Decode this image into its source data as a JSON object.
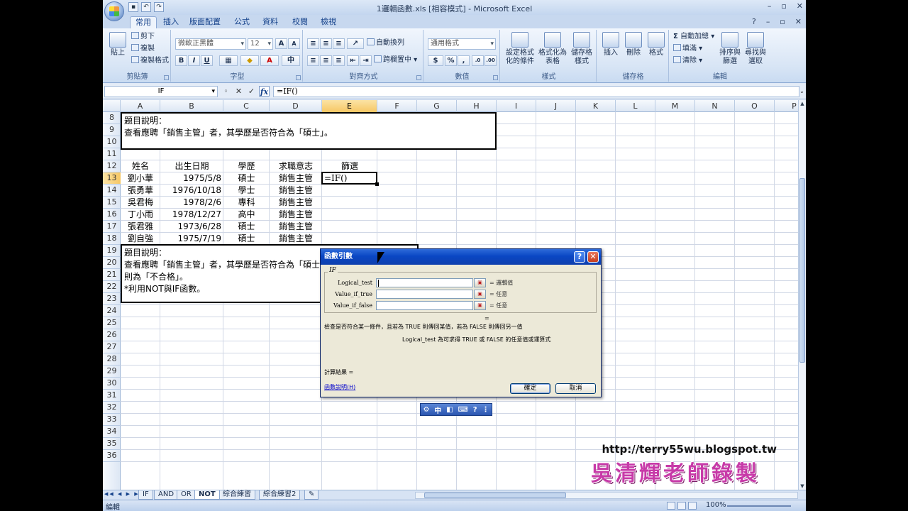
{
  "window": {
    "title": "1邏輯函數.xls [相容模式] - Microsoft Excel",
    "min": "–",
    "restore": "▫",
    "close": "✕"
  },
  "ribbon_tabs": [
    "常用",
    "插入",
    "版面配置",
    "公式",
    "資料",
    "校閱",
    "檢視"
  ],
  "ribbon": {
    "clipboard": {
      "label": "剪貼簿",
      "paste": "貼上",
      "cut": "剪下",
      "copy": "複製",
      "format_painter": "複製格式"
    },
    "font": {
      "label": "字型",
      "font_name": "微軟正黑體",
      "font_size": "12",
      "bold": "B",
      "italic": "I",
      "underline": "U"
    },
    "alignment": {
      "label": "對齊方式",
      "wrap": "自動換列",
      "merge": "跨欄置中"
    },
    "number": {
      "label": "數值",
      "format": "通用格式",
      "currency": "$",
      "percent": "%",
      "comma": ","
    },
    "styles": {
      "label": "樣式",
      "conditional": "設定格式化的條件",
      "table": "格式化為表格",
      "cell_styles": "儲存格樣式"
    },
    "cells": {
      "label": "儲存格",
      "insert": "插入",
      "delete": "刪除",
      "format": "格式"
    },
    "editing": {
      "label": "編輯",
      "autosum": "自動加總",
      "fill": "填滿",
      "clear": "清除",
      "sort": "排序與篩選",
      "find": "尋找與選取"
    }
  },
  "formula_bar": {
    "name_box": "IF",
    "cancel": "✕",
    "enter": "✓",
    "fx": "fx",
    "formula": "=IF()"
  },
  "columns": [
    "A",
    "B",
    "C",
    "D",
    "E",
    "F",
    "G",
    "H",
    "I",
    "J",
    "K",
    "L",
    "M",
    "N",
    "O",
    "P"
  ],
  "rows": [
    "8",
    "9",
    "10",
    "11",
    "12",
    "13",
    "14",
    "15",
    "16",
    "17",
    "18",
    "19",
    "20",
    "21",
    "22",
    "23",
    "24",
    "25",
    "26",
    "27",
    "28",
    "29",
    "30",
    "31",
    "32",
    "33",
    "34",
    "35",
    "36"
  ],
  "note1": {
    "line1": "題目說明：",
    "line2": "查看應聘「銷售主管」者，其學歷是否符合為「碩士」。"
  },
  "table": {
    "headers": [
      "姓名",
      "出生日期",
      "學歷",
      "求職意志",
      "篩選"
    ],
    "rows": [
      [
        "劉小華",
        "1975/5/8",
        "碩士",
        "銷售主管"
      ],
      [
        "張勇華",
        "1976/10/18",
        "學士",
        "銷售主管"
      ],
      [
        "吳君梅",
        "1978/2/6",
        "專科",
        "銷售主管"
      ],
      [
        "丁小雨",
        "1978/12/27",
        "高中",
        "銷售主管"
      ],
      [
        "張君雅",
        "1973/6/28",
        "碩士",
        "銷售主管"
      ],
      [
        "劉自強",
        "1975/7/19",
        "碩士",
        "銷售主管"
      ]
    ],
    "active_cell": "=IF()"
  },
  "note2": {
    "line1": "題目說明：",
    "line2": "查看應聘「銷售主管」者，其學歷是否符合為「碩士",
    "line3": "則為「不合格」。",
    "line4": "*利用NOT與IF函數。"
  },
  "sheet_tabs": [
    "IF",
    "AND",
    "OR",
    "NOT",
    "綜合練習",
    "綜合練習2"
  ],
  "status": {
    "mode": "編輯",
    "zoom": "100%"
  },
  "dialog": {
    "title": "函數引數",
    "function_name": "IF",
    "args": [
      {
        "label": "Logical_test",
        "value": "= 邏輯值"
      },
      {
        "label": "Value_if_true",
        "value": "= 任意"
      },
      {
        "label": "Value_if_false",
        "value": "= 任意"
      }
    ],
    "equals": "=",
    "description": "檢查是否符合某一條件，且若為 TRUE 則傳回某值，若為 FALSE 則傳回另一值",
    "arg_help": "Logical_test  為可求得 TRUE 或 FALSE 的任意值或運算式",
    "result_label": "計算結果 =",
    "help_link": "函數說明(H)",
    "ok": "確定",
    "cancel": "取消",
    "help_btn": "?",
    "close_btn": "✕"
  },
  "ime": {
    "mode": "中"
  },
  "watermark": {
    "url": "http://terry55wu.blogspot.tw",
    "author": "吳清輝老師錄製"
  }
}
